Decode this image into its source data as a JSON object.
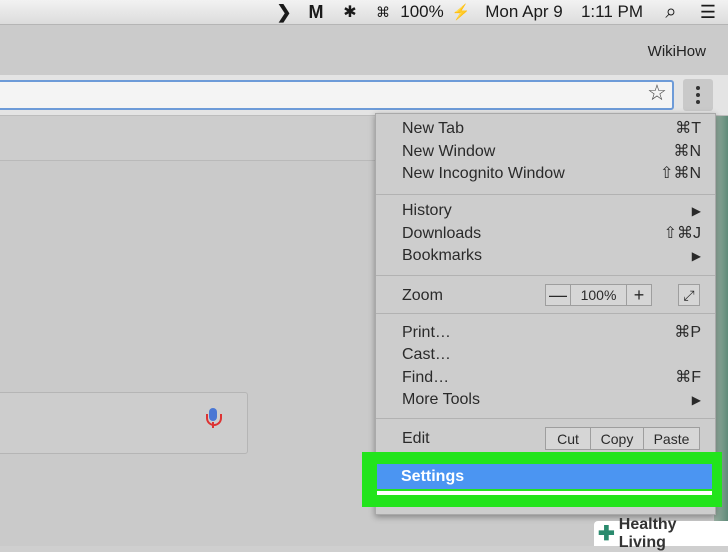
{
  "menubar": {
    "items": [
      {
        "label": "❯",
        "icon": "chevron-right-icon"
      },
      {
        "label": "M",
        "icon": "malwarebytes-icon"
      },
      {
        "label": "✱",
        "icon": "bluetooth-icon"
      },
      {
        "label": "⌘",
        "icon": "keyboard-icon"
      },
      {
        "label": "100%",
        "icon": ""
      },
      {
        "label": "⚡",
        "icon": "battery-icon"
      },
      {
        "label": "Mon Apr 9",
        "icon": ""
      },
      {
        "label": "1:11 PM",
        "icon": ""
      },
      {
        "label": "⌕",
        "icon": "search-icon"
      },
      {
        "label": "☰",
        "icon": "list-icon"
      }
    ]
  },
  "profile": "WikiHow",
  "toolbar": {
    "star_icon": "☆"
  },
  "menu": {
    "new_tab": "New Tab",
    "new_tab_sc": "⌘T",
    "new_window": "New Window",
    "new_window_sc": "⌘N",
    "incognito": "New Incognito Window",
    "incognito_sc": "⇧⌘N",
    "history": "History",
    "history_arrow": "▶",
    "downloads": "Downloads",
    "downloads_sc": "⇧⌘J",
    "bookmarks": "Bookmarks",
    "bookmarks_arrow": "▶",
    "zoom": "Zoom",
    "zoom_minus": "—",
    "zoom_value": "100%",
    "zoom_plus": "+",
    "fullscreen": "⤢",
    "print": "Print…",
    "print_sc": "⌘P",
    "cast": "Cast…",
    "find": "Find…",
    "find_sc": "⌘F",
    "more_tools": "More Tools",
    "more_tools_arrow": "▶",
    "edit": "Edit",
    "cut": "Cut",
    "copy": "Copy",
    "paste": "Paste",
    "settings": "Settings"
  },
  "watermark": {
    "plus": "✚",
    "label": "Healthy Living"
  },
  "colors": {
    "highlight": "#22e41c",
    "selected": "#4b95f2"
  }
}
